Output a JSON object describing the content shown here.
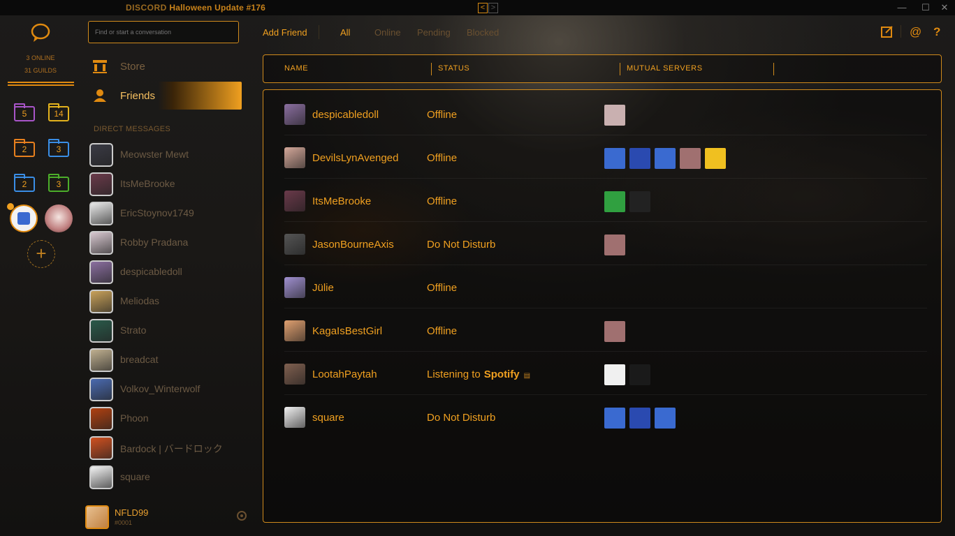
{
  "titlebar": {
    "brand": "DISCORD",
    "title": "Halloween Update #176",
    "back": "<",
    "forward": ">",
    "minimize": "—",
    "maximize": "☐",
    "close": "✕"
  },
  "guilds": {
    "online": "3 ONLINE",
    "guild_count": "31 GUILDS",
    "folders": [
      {
        "count": "5",
        "color": "#a855c8"
      },
      {
        "count": "14",
        "color": "#e2b21d"
      },
      {
        "count": "2",
        "color": "#e8801e"
      },
      {
        "count": "3",
        "color": "#3a8ee6"
      },
      {
        "count": "2",
        "color": "#3a8ee6"
      },
      {
        "count": "3",
        "color": "#4cae2a"
      }
    ],
    "add": "+"
  },
  "channels": {
    "search_placeholder": "Find or start a conversation",
    "store": "Store",
    "friends": "Friends",
    "dm_header": "DIRECT MESSAGES",
    "dms": [
      {
        "name": "Meowster Mewt",
        "color": "#3a3a44"
      },
      {
        "name": "ItsMeBrooke",
        "color": "#6a3a4a"
      },
      {
        "name": "EricStoynov1749",
        "color": "#e9e9e9"
      },
      {
        "name": "Robby Pradana",
        "color": "#d8c8d0"
      },
      {
        "name": "despicabledoll",
        "color": "#8b6fa0"
      },
      {
        "name": "Meliodas",
        "color": "#c9a25a"
      },
      {
        "name": "Strato",
        "color": "#2a5a4a"
      },
      {
        "name": "breadcat",
        "color": "#c0b090"
      },
      {
        "name": "Volkov_Winterwolf",
        "color": "#4a6ab0"
      },
      {
        "name": "Phoon",
        "color": "#b04010"
      },
      {
        "name": "Bardock | バードロック",
        "color": "#d05020"
      },
      {
        "name": "square",
        "color": "#f2f2f2"
      }
    ],
    "user": {
      "name": "NFLD99",
      "tag": "#0001"
    }
  },
  "tabs": {
    "add_friend": "Add Friend",
    "all": "All",
    "online": "Online",
    "pending": "Pending",
    "blocked": "Blocked"
  },
  "table": {
    "headers": {
      "name": "NAME",
      "status": "STATUS",
      "mutual": "MUTUAL SERVERS"
    },
    "rows": [
      {
        "name": "despicabledoll",
        "status": "Offline",
        "avatar": "#8b6fa0",
        "servers": [
          "#c9b0b0"
        ]
      },
      {
        "name": "DevilsLynAvenged",
        "status": "Offline",
        "avatar": "#d4a89a",
        "servers": [
          "#3a6ad0",
          "#2a4ab0",
          "#3a6ad0",
          "#a07070",
          "#f0c020"
        ]
      },
      {
        "name": "ItsMeBrooke",
        "status": "Offline",
        "avatar": "#6a3a4a",
        "servers": [
          "#30a040",
          "#222222"
        ]
      },
      {
        "name": "JasonBourneAxis",
        "status": "Do Not Disturb",
        "avatar": "#555555",
        "servers": [
          "#a07070"
        ]
      },
      {
        "name": "Jülie",
        "status": "Offline",
        "avatar": "#a090d0",
        "servers": []
      },
      {
        "name": "KagaIsBestGirl",
        "status": "Offline",
        "avatar": "#e0a070",
        "servers": [
          "#a07070"
        ]
      },
      {
        "name": "LootahPaytah",
        "status": "Listening to",
        "status_extra": "Spotify",
        "avatar": "#806050",
        "servers": [
          "#f0f0f0",
          "#1a1a1a"
        ]
      },
      {
        "name": "square",
        "status": "Do Not Disturb",
        "avatar": "#f2f2f2",
        "servers": [
          "#3a6ad0",
          "#2a4ab0",
          "#3a6ad0"
        ]
      }
    ]
  },
  "colors": {
    "accent": "#f0a020",
    "border": "#d08a1c"
  }
}
